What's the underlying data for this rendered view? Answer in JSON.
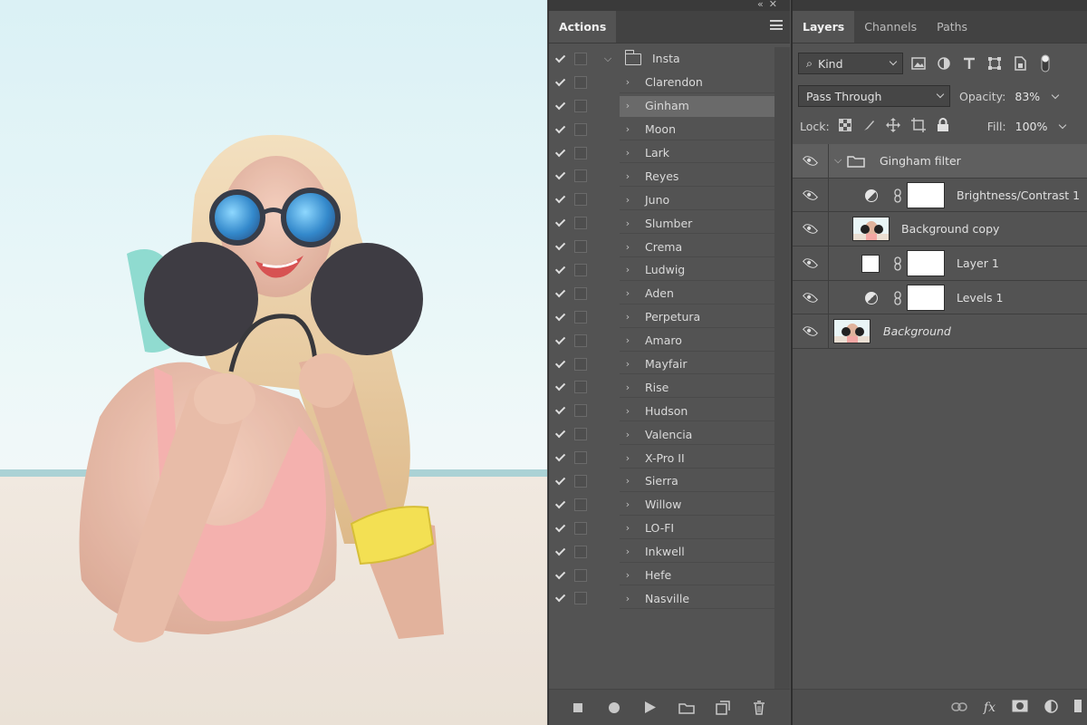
{
  "window": {
    "collapse_icon": "double-chevron-icon",
    "close_icon": "close-icon"
  },
  "actions_panel": {
    "tab": "Actions",
    "group": {
      "name": "Insta",
      "checked": true
    },
    "items": [
      {
        "name": "Clarendon",
        "checked": true,
        "selected": false
      },
      {
        "name": "Ginham",
        "checked": true,
        "selected": true
      },
      {
        "name": "Moon",
        "checked": true,
        "selected": false
      },
      {
        "name": "Lark",
        "checked": true,
        "selected": false
      },
      {
        "name": "Reyes",
        "checked": true,
        "selected": false
      },
      {
        "name": "Juno",
        "checked": true,
        "selected": false
      },
      {
        "name": "Slumber",
        "checked": true,
        "selected": false
      },
      {
        "name": "Crema",
        "checked": true,
        "selected": false
      },
      {
        "name": "Ludwig",
        "checked": true,
        "selected": false
      },
      {
        "name": "Aden",
        "checked": true,
        "selected": false
      },
      {
        "name": "Perpetura",
        "checked": true,
        "selected": false
      },
      {
        "name": "Amaro",
        "checked": true,
        "selected": false
      },
      {
        "name": "Mayfair",
        "checked": true,
        "selected": false
      },
      {
        "name": "Rise",
        "checked": true,
        "selected": false
      },
      {
        "name": "Hudson",
        "checked": true,
        "selected": false
      },
      {
        "name": "Valencia",
        "checked": true,
        "selected": false
      },
      {
        "name": "X-Pro II",
        "checked": true,
        "selected": false
      },
      {
        "name": "Sierra",
        "checked": true,
        "selected": false
      },
      {
        "name": "Willow",
        "checked": true,
        "selected": false
      },
      {
        "name": "LO-FI",
        "checked": true,
        "selected": false
      },
      {
        "name": "Inkwell",
        "checked": true,
        "selected": false
      },
      {
        "name": "Hefe",
        "checked": true,
        "selected": false
      },
      {
        "name": "Nasville",
        "checked": true,
        "selected": false
      }
    ],
    "bottom_icons": [
      "stop-icon",
      "record-icon",
      "play-icon",
      "new-set-icon",
      "new-action-icon",
      "trash-icon"
    ]
  },
  "layers_panel": {
    "tabs": [
      {
        "label": "Layers",
        "active": true
      },
      {
        "label": "Channels",
        "active": false
      },
      {
        "label": "Paths",
        "active": false
      }
    ],
    "filter_kind": "Kind",
    "filter_icons": [
      "image-filter-icon",
      "adjustment-filter-icon",
      "type-filter-icon",
      "shape-filter-icon",
      "smart-object-filter-icon",
      "filter-toggle-icon"
    ],
    "blend_mode": "Pass Through",
    "opacity_label": "Opacity:",
    "opacity_value": "83%",
    "lock_label": "Lock:",
    "lock_icons": [
      "lock-transparent-icon",
      "lock-paint-icon",
      "lock-position-icon",
      "lock-artboard-icon",
      "lock-all-icon"
    ],
    "fill_label": "Fill:",
    "fill_value": "100%",
    "layers": [
      {
        "name": "Gingham filter",
        "kind": "group",
        "visible": true,
        "expanded": true
      },
      {
        "name": "Brightness/Contrast 1",
        "kind": "adjustment",
        "visible": true
      },
      {
        "name": "Background copy",
        "kind": "photo",
        "visible": true
      },
      {
        "name": "Layer 1",
        "kind": "layer-with-mask",
        "visible": true
      },
      {
        "name": "Levels 1",
        "kind": "adjustment",
        "visible": true
      },
      {
        "name": "Background",
        "kind": "background",
        "visible": true
      }
    ],
    "bottom_icons": [
      "link-icon",
      "fx-icon",
      "mask-icon",
      "adjustment-layer-icon",
      "new-group-icon"
    ],
    "fx_label": "fx"
  }
}
